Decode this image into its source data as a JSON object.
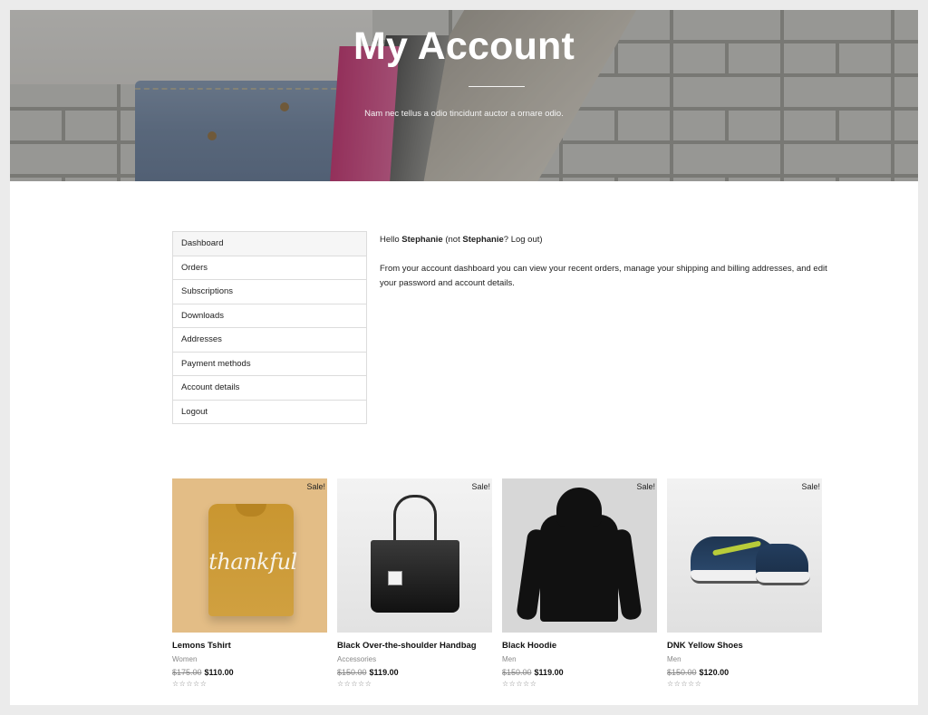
{
  "hero": {
    "title": "My Account",
    "subtitle": "Nam nec tellus a odio tincidunt auctor a ornare odio."
  },
  "account_nav": {
    "items": [
      {
        "label": "Dashboard",
        "active": true
      },
      {
        "label": "Orders",
        "active": false
      },
      {
        "label": "Subscriptions",
        "active": false
      },
      {
        "label": "Downloads",
        "active": false
      },
      {
        "label": "Addresses",
        "active": false
      },
      {
        "label": "Payment methods",
        "active": false
      },
      {
        "label": "Account details",
        "active": false
      },
      {
        "label": "Logout",
        "active": false
      }
    ]
  },
  "dashboard": {
    "hello_prefix": "Hello ",
    "user_name": "Stephanie",
    "not_prefix": " (not ",
    "not_user": "Stephanie",
    "logout_text": "? Log out)",
    "intro": "From your account dashboard you can view your recent orders, manage your shipping and billing addresses, and edit your password and account details."
  },
  "products": [
    {
      "name": "Lemons Tshirt",
      "category": "Women",
      "old_price": "$175.00",
      "new_price": "$110.00",
      "badge": "Sale!",
      "stars": "☆☆☆☆☆",
      "print_text": "thankful",
      "image_icon": "tshirt-image"
    },
    {
      "name": "Black Over-the-shoulder Handbag",
      "category": "Accessories",
      "old_price": "$150.00",
      "new_price": "$119.00",
      "badge": "Sale!",
      "stars": "☆☆☆☆☆",
      "image_icon": "handbag-image"
    },
    {
      "name": "Black Hoodie",
      "category": "Men",
      "old_price": "$150.00",
      "new_price": "$119.00",
      "badge": "Sale!",
      "stars": "☆☆☆☆☆",
      "image_icon": "hoodie-image"
    },
    {
      "name": "DNK Yellow Shoes",
      "category": "Men",
      "old_price": "$150.00",
      "new_price": "$120.00",
      "badge": "Sale!",
      "stars": "☆☆☆☆☆",
      "image_icon": "shoes-image"
    }
  ],
  "colors": {
    "page_bg": "#ebebeb",
    "nav_active_bg": "#f6f6f6",
    "border": "#dcdcdc"
  }
}
